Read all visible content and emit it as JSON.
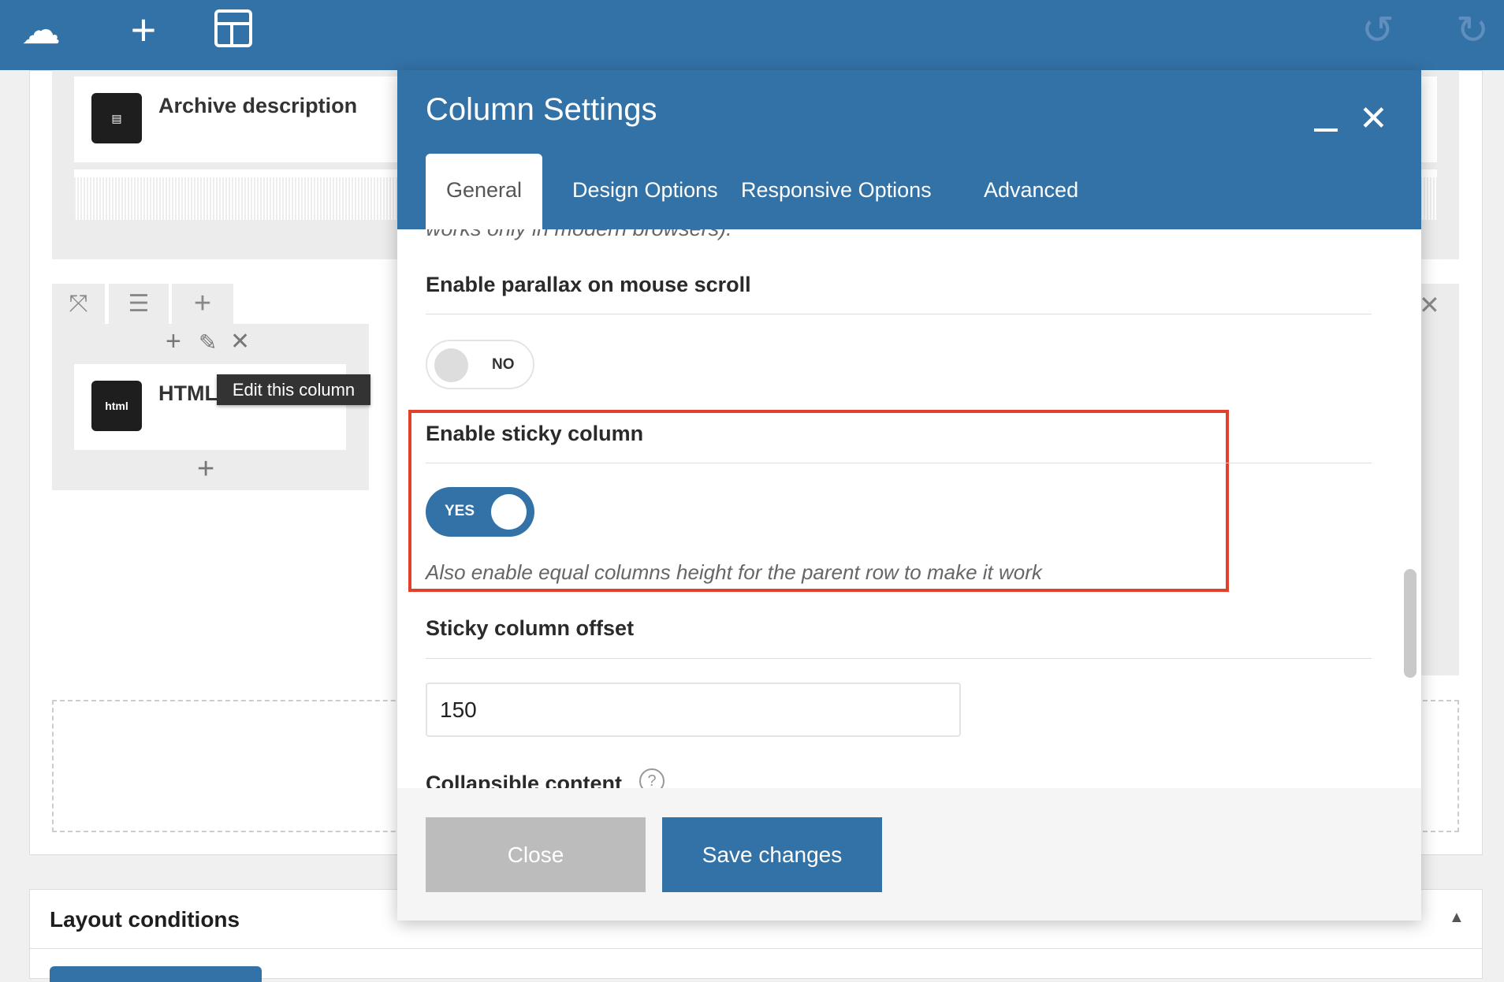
{
  "toolbar": {
    "icons": [
      "logo-icon",
      "plus-icon",
      "layout-icon",
      "undo-icon",
      "redo-icon"
    ]
  },
  "builder": {
    "archive_element": "Archive description",
    "html_element": "HTML",
    "tooltip": "Edit this column"
  },
  "modal": {
    "title": "Column Settings",
    "tabs": [
      {
        "label": "General",
        "active": true
      },
      {
        "label": "Design Options"
      },
      {
        "label": "Responsive Options"
      },
      {
        "label": "Advanced"
      }
    ],
    "partial_text": "works only in modern browsers).",
    "parallax_label": "Enable parallax on mouse scroll",
    "parallax_value": "NO",
    "sticky_label": "Enable sticky column",
    "sticky_value": "YES",
    "sticky_help": "Also enable equal columns height for the parent row to make it work",
    "offset_label": "Sticky column offset",
    "offset_value": "150",
    "collapsible_label": "Collapsible content",
    "close_label": "Close",
    "save_label": "Save changes"
  },
  "layout_conditions": {
    "title": "Layout conditions"
  },
  "colors": {
    "accent": "#3372a7",
    "highlight": "#e2402b"
  }
}
